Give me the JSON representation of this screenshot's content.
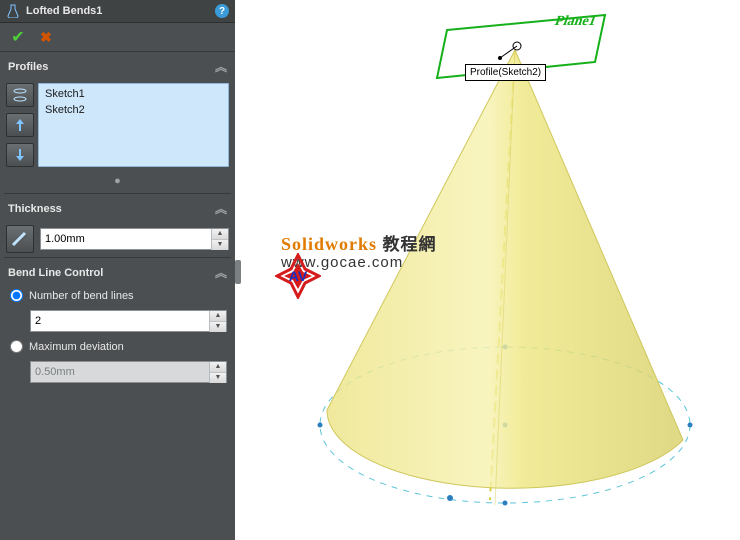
{
  "header": {
    "title": "Lofted Bends1"
  },
  "profiles": {
    "section_label": "Profiles",
    "items": [
      {
        "label": "Sketch1"
      },
      {
        "label": "Sketch2"
      }
    ]
  },
  "thickness": {
    "section_label": "Thickness",
    "value": "1.00mm"
  },
  "bend": {
    "section_label": "Bend Line Control",
    "number_label": "Number of bend lines",
    "number_value": "2",
    "maxdev_label": "Maximum deviation",
    "maxdev_value": "0.50mm",
    "selected": "number"
  },
  "viewport": {
    "plane_label": "Plane1",
    "profile_tag": "Profile(Sketch2)"
  },
  "watermark": {
    "line1_a": "Solidworks",
    "line1_b": "教程網",
    "line2": "www.gocae.com"
  },
  "colors": {
    "cone_fill": "#f2ea88",
    "cone_edge": "#d8cf5a",
    "plane": "#15b01a",
    "base_ellipse": "#5bc5d8"
  }
}
